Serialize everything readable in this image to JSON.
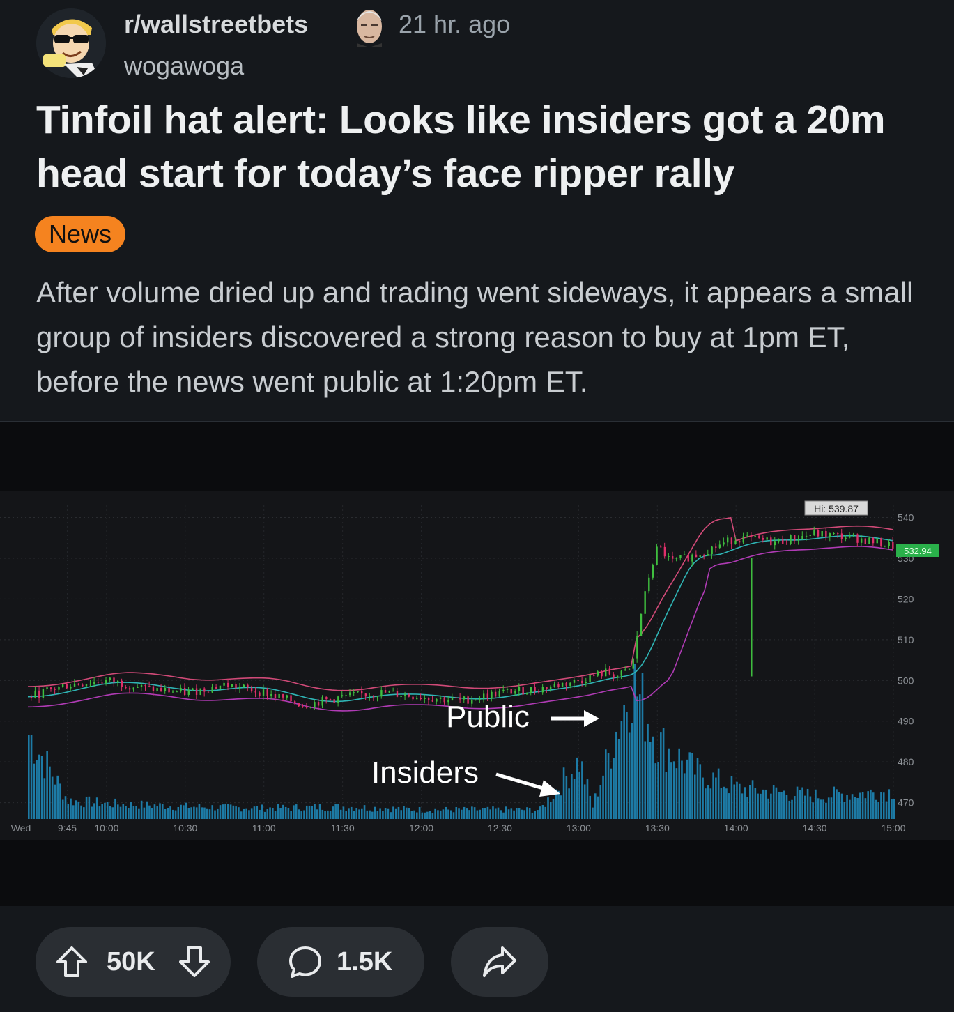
{
  "post": {
    "subreddit": "r/wallstreetbets",
    "time_ago": "21 hr. ago",
    "author": "wogawoga",
    "title": "Tinfoil hat alert: Looks like insiders got a 20m head start for today’s face ripper rally",
    "flair": "News",
    "body": "After volume dried up and trading went sideways, it appears a small group of insiders discovered a strong reason to buy at 1pm ET, before the news went public at 1:20pm ET."
  },
  "actions": {
    "upvotes": "50K",
    "comments": "1.5K"
  },
  "colors": {
    "accent_flair": "#f5831f",
    "background": "#15181c",
    "chart_volume": "#1d7ba6",
    "chart_up": "#3fbf3f",
    "chart_down": "#e0306a",
    "chart_band_upper": "#d14a78",
    "chart_band_lower": "#b03bb5",
    "chart_vwap": "#2fb5b5"
  },
  "chart_data": {
    "type": "line",
    "title": "",
    "xlabel": "",
    "ylabel": "",
    "x_tick_labels": [
      "Wed",
      "9:45",
      "10:00",
      "10:30",
      "11:00",
      "11:30",
      "12:00",
      "12:30",
      "13:00",
      "13:30",
      "14:00",
      "14:30",
      "15:00"
    ],
    "y_tick_labels": [
      "540",
      "530",
      "520",
      "510",
      "500",
      "490",
      "480",
      "470"
    ],
    "ylim": [
      466,
      543
    ],
    "high_label": "Hi: 539.87",
    "last_price_label": "532.94",
    "annotations": [
      "Public",
      "Insiders"
    ],
    "series": [
      {
        "values": [
          {
            "x": "9:30",
            "y": 496
          },
          {
            "x": "9:45",
            "y": 499
          },
          {
            "x": "10:00",
            "y": 500
          },
          {
            "x": "10:15",
            "y": 498
          },
          {
            "x": "10:30",
            "y": 497
          },
          {
            "x": "10:45",
            "y": 499
          },
          {
            "x": "11:00",
            "y": 497
          },
          {
            "x": "11:15",
            "y": 494
          },
          {
            "x": "11:30",
            "y": 496
          },
          {
            "x": "11:45",
            "y": 497
          },
          {
            "x": "12:00",
            "y": 496
          },
          {
            "x": "12:15",
            "y": 495
          },
          {
            "x": "12:30",
            "y": 497
          },
          {
            "x": "12:45",
            "y": 498
          },
          {
            "x": "13:00",
            "y": 500
          },
          {
            "x": "13:05",
            "y": 501
          },
          {
            "x": "13:10",
            "y": 502
          },
          {
            "x": "13:15",
            "y": 501
          },
          {
            "x": "13:20",
            "y": 503
          },
          {
            "x": "13:23",
            "y": 515
          },
          {
            "x": "13:27",
            "y": 527
          },
          {
            "x": "13:30",
            "y": 533
          },
          {
            "x": "13:35",
            "y": 529
          },
          {
            "x": "13:40",
            "y": 530
          },
          {
            "x": "13:45",
            "y": 531
          },
          {
            "x": "14:00",
            "y": 535
          },
          {
            "x": "14:15",
            "y": 534
          },
          {
            "x": "14:30",
            "y": 536
          },
          {
            "x": "14:45",
            "y": 535
          },
          {
            "x": "15:00",
            "y": 533
          }
        ]
      }
    ],
    "volume": [
      {
        "x": "9:30",
        "v": 0.55
      },
      {
        "x": "9:45",
        "v": 0.12
      },
      {
        "x": "10:00",
        "v": 0.1
      },
      {
        "x": "10:30",
        "v": 0.08
      },
      {
        "x": "11:00",
        "v": 0.07
      },
      {
        "x": "11:30",
        "v": 0.08
      },
      {
        "x": "12:00",
        "v": 0.06
      },
      {
        "x": "12:30",
        "v": 0.06
      },
      {
        "x": "12:45",
        "v": 0.06
      },
      {
        "x": "13:00",
        "v": 0.38
      },
      {
        "x": "13:05",
        "v": 0.08
      },
      {
        "x": "13:20",
        "v": 0.9
      },
      {
        "x": "13:25",
        "v": 0.7
      },
      {
        "x": "13:30",
        "v": 0.5
      },
      {
        "x": "13:45",
        "v": 0.3
      },
      {
        "x": "14:00",
        "v": 0.2
      },
      {
        "x": "14:30",
        "v": 0.15
      },
      {
        "x": "15:00",
        "v": 0.18
      }
    ]
  }
}
